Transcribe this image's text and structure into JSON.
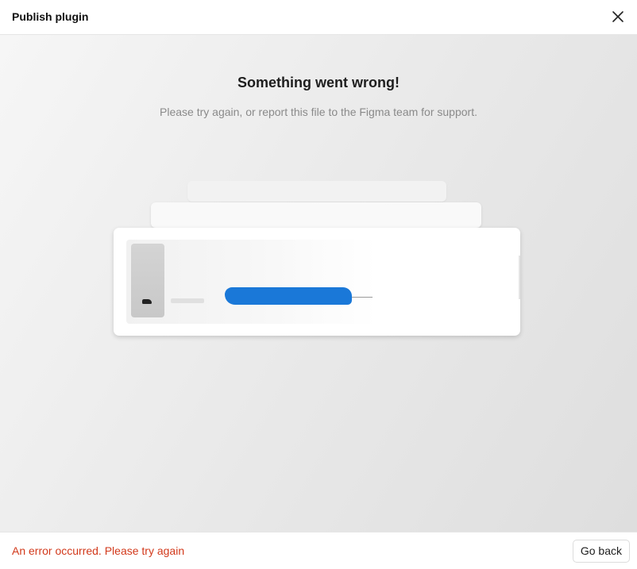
{
  "header": {
    "title": "Publish plugin",
    "close_icon": "close-icon"
  },
  "main": {
    "title": "Something went wrong!",
    "subtitle": "Please try again, or report this file to the Figma team for support."
  },
  "footer": {
    "error_text": "An error occurred. Please try again",
    "go_back_label": "Go back"
  },
  "colors": {
    "error": "#d2391b",
    "redaction": "#1a78d8"
  }
}
